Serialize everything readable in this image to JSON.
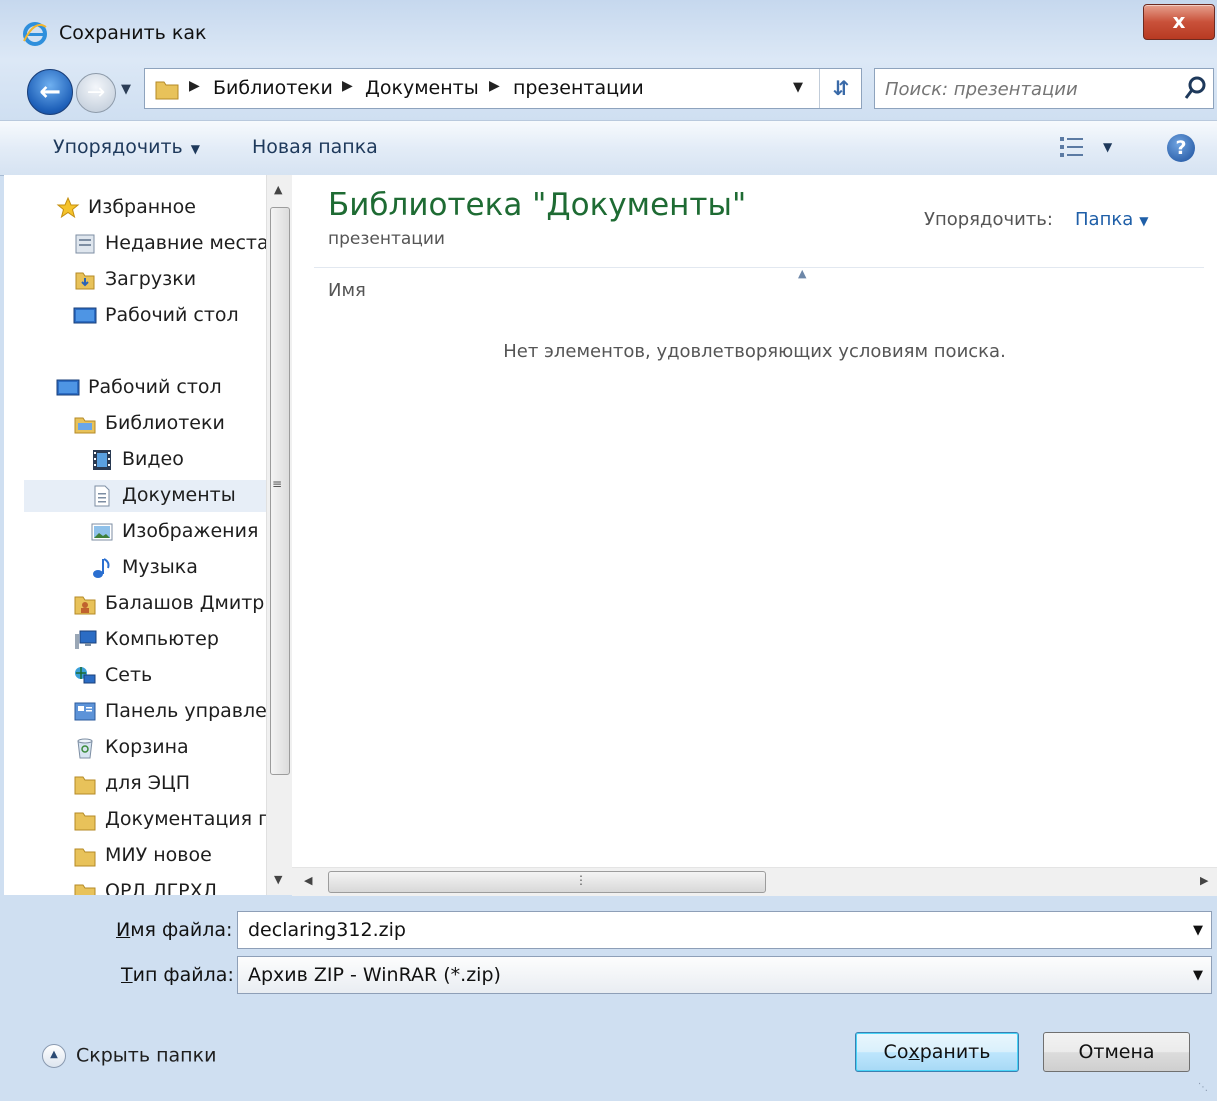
{
  "window": {
    "title": "Сохранить как",
    "close_label": "x"
  },
  "address": {
    "crumbs": [
      "Библиотеки",
      "Документы",
      "презентации"
    ],
    "search_placeholder": "Поиск: презентации"
  },
  "toolbar": {
    "organize_label": "Упорядочить",
    "new_folder_label": "Новая папка",
    "help_label": "?"
  },
  "nav": {
    "items": [
      {
        "label": "Избранное",
        "icon": "star-icon"
      },
      {
        "label": "Недавние места",
        "icon": "recent-places-icon"
      },
      {
        "label": "Загрузки",
        "icon": "downloads-folder-icon"
      },
      {
        "label": "Рабочий стол",
        "icon": "desktop-icon"
      },
      {
        "label": "Рабочий стол",
        "icon": "desktop-icon"
      },
      {
        "label": "Библиотеки",
        "icon": "libraries-icon"
      },
      {
        "label": "Видео",
        "icon": "video-icon"
      },
      {
        "label": "Документы",
        "icon": "documents-icon"
      },
      {
        "label": "Изображения",
        "icon": "pictures-icon"
      },
      {
        "label": "Музыка",
        "icon": "music-icon"
      },
      {
        "label": "Балашов Дмитр",
        "icon": "user-folder-icon"
      },
      {
        "label": "Компьютер",
        "icon": "computer-icon"
      },
      {
        "label": "Сеть",
        "icon": "network-icon"
      },
      {
        "label": "Панель управле",
        "icon": "control-panel-icon"
      },
      {
        "label": "Корзина",
        "icon": "recycle-bin-icon"
      },
      {
        "label": "для ЭЦП",
        "icon": "folder-icon"
      },
      {
        "label": "Документация п",
        "icon": "folder-icon"
      },
      {
        "label": "МИУ новое",
        "icon": "folder-icon"
      },
      {
        "label": "ОРД ЛГРХЛ",
        "icon": "folder-icon"
      }
    ],
    "selected_index": 7
  },
  "content": {
    "library_title": "Библиотека \"Документы\"",
    "library_subtitle": "презентации",
    "arrange_label": "Упорядочить:",
    "arrange_value": "Папка",
    "column_name": "Имя",
    "empty_message": "Нет элементов, удовлетворяющих условиям поиска."
  },
  "form": {
    "filename_label_accel": "И",
    "filename_label_rest": "мя файла:",
    "filename_value": "declaring312.zip",
    "filetype_label_accel": "Т",
    "filetype_label_rest": "ип файла:",
    "filetype_value": "Архив ZIP - WinRAR (*.zip)"
  },
  "footer": {
    "hide_folders_label": "Скрыть папки",
    "save_label_pre": "Со",
    "save_label_accel": "х",
    "save_label_post": "ранить",
    "cancel_label": "Отмена"
  },
  "colors": {
    "accent": "#1f5fa8",
    "library_title": "#1e6b33",
    "selection": "#e7eef7"
  }
}
